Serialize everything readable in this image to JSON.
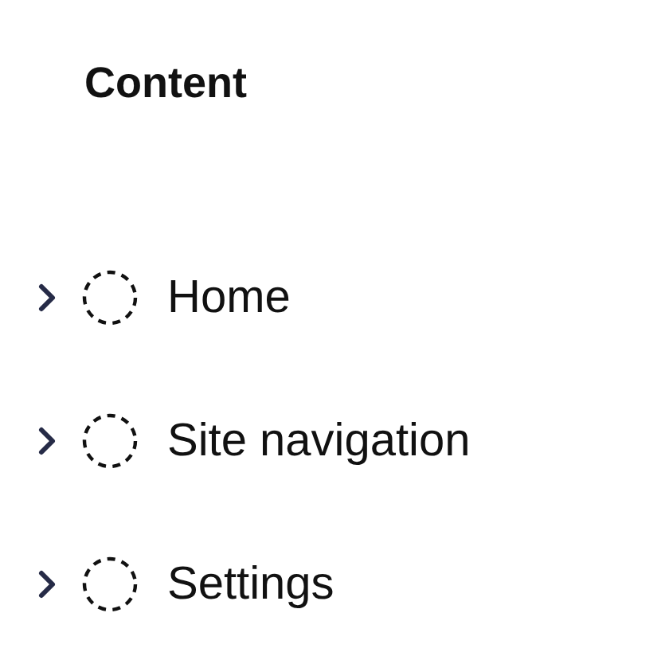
{
  "title": "Content",
  "tree": [
    {
      "label": "Home",
      "expanded": false
    },
    {
      "label": "Site navigation",
      "expanded": false
    },
    {
      "label": "Settings",
      "expanded": false
    }
  ]
}
